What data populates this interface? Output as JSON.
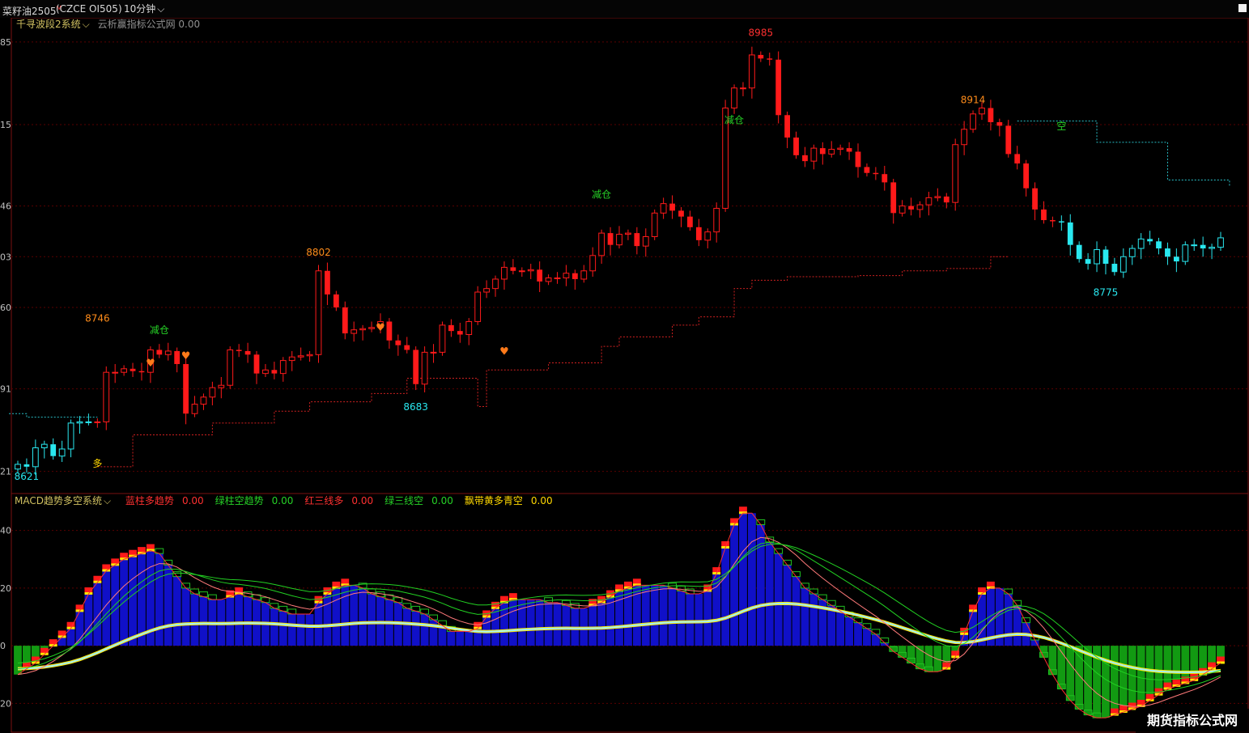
{
  "header": {
    "symbol": "菜籽油2505",
    "symbol_mark": "M",
    "code": "(CZCE OI505)",
    "period": "10分钟",
    "period_caret": "⌵"
  },
  "main_panel": {
    "indicator_name": "千寻波段2系统",
    "indicator_caret": "⌵",
    "formula_text": "云析赢指标公式网 0.00",
    "y_ticks": [
      {
        "label": "85",
        "value": 8985
      },
      {
        "label": "15",
        "value": 8915
      },
      {
        "label": "46",
        "value": 8846
      },
      {
        "label": "03",
        "value": 8803
      },
      {
        "label": "60",
        "value": 8760
      },
      {
        "label": "91",
        "value": 8691
      },
      {
        "label": "21",
        "value": 8621
      }
    ],
    "colors": {
      "up_red": "#ff1a1a",
      "down_red": "#ff1a1a",
      "cyan": "#29e8f0",
      "yellow_price": "#ff8c1a",
      "green_text": "#26d126"
    },
    "annotations": [
      {
        "text": "8621",
        "idx": 1,
        "price": 8614,
        "color": "#29e8f0"
      },
      {
        "text": "多",
        "idx": 9,
        "price": 8625,
        "color": "#ffd800"
      },
      {
        "text": "8746",
        "idx": 9,
        "price": 8748,
        "color": "#ff8c1a"
      },
      {
        "text": "减仓",
        "idx": 16,
        "price": 8738,
        "color": "#26d126"
      },
      {
        "text": "8802",
        "idx": 34,
        "price": 8804,
        "color": "#ff8c1a"
      },
      {
        "text": "8683",
        "idx": 45,
        "price": 8673,
        "color": "#29e8f0"
      },
      {
        "text": "减仓",
        "idx": 66,
        "price": 8853,
        "color": "#26d126"
      },
      {
        "text": "8985",
        "idx": 84,
        "price": 8990,
        "color": "#ff3030"
      },
      {
        "text": "减仓",
        "idx": 81,
        "price": 8916,
        "color": "#26d126"
      },
      {
        "text": "8914",
        "idx": 108,
        "price": 8933,
        "color": "#ff8c1a"
      },
      {
        "text": "空",
        "idx": 118,
        "price": 8911,
        "color": "#26d126"
      },
      {
        "text": "8775",
        "idx": 123,
        "price": 8770,
        "color": "#29e8f0"
      }
    ]
  },
  "macd_panel": {
    "indicator_name": "MACD趋势多空系统",
    "indicator_caret": "⌵",
    "legend": [
      {
        "label": "蓝柱多趋势",
        "value": "0.00",
        "label_color": "#ff3030",
        "value_color": "#ff3030"
      },
      {
        "label": "绿柱空趋势",
        "value": "0.00",
        "label_color": "#26d126",
        "value_color": "#26d126"
      },
      {
        "label": "红三线多",
        "value": "0.00",
        "label_color": "#ff3030",
        "value_color": "#ff3030"
      },
      {
        "label": "绿三线空",
        "value": "0.00",
        "label_color": "#26d126",
        "value_color": "#26d126"
      },
      {
        "label": "飘带黄多青空",
        "value": "0.00",
        "label_color": "#ffd800",
        "value_color": "#ffd800"
      }
    ],
    "y_ticks": [
      {
        "label": "40",
        "value": 40
      },
      {
        "label": "20",
        "value": 20
      },
      {
        "label": "0",
        "value": 0
      },
      {
        "label": "20",
        "value": -20
      }
    ]
  },
  "watermark": "期货指标公式网",
  "chart_data": {
    "type": "candlestick",
    "x_unit": "bar index (10-minute bars)",
    "candles_close": [
      8627,
      8625,
      8641,
      8644,
      8634,
      8640,
      8662,
      8663,
      8663,
      8663,
      8705,
      8705,
      8708,
      8706,
      8705,
      8724,
      8720,
      8723,
      8712,
      8670,
      8678,
      8684,
      8692,
      8694,
      8724,
      8723,
      8720,
      8704,
      8707,
      8704,
      8715,
      8718,
      8719,
      8720,
      8791,
      8771,
      8760,
      8738,
      8741,
      8742,
      8743,
      8748,
      8732,
      8728,
      8724,
      8695,
      8722,
      8722,
      8745,
      8740,
      8737,
      8748,
      8773,
      8776,
      8784,
      8794,
      8791,
      8791,
      8792,
      8782,
      8785,
      8785,
      8789,
      8784,
      8791,
      8804,
      8823,
      8813,
      8822,
      8823,
      8812,
      8820,
      8840,
      8848,
      8842,
      8837,
      8828,
      8817,
      8824,
      8844,
      8929,
      8946,
      8946,
      8974,
      8971,
      8970,
      8923,
      8904,
      8889,
      8884,
      8895,
      8890,
      8894,
      8895,
      8892,
      8879,
      8874,
      8873,
      8866,
      8840,
      8846,
      8843,
      8847,
      8853,
      8854,
      8849,
      8898,
      8911,
      8924,
      8929,
      8917,
      8914,
      8890,
      8882,
      8861,
      8843,
      8834,
      8833,
      8832,
      8813,
      8801,
      8797,
      8809,
      8797,
      8790,
      8803,
      8810,
      8818,
      8816,
      8810,
      8803,
      8799,
      8813,
      8813,
      8810,
      8811,
      8819
    ],
    "macd_histogram_note": "blue bars above zero = bullish, green below = bearish",
    "macd_dif_sample": [
      -10,
      -8,
      -6,
      -3,
      0,
      3,
      6,
      12,
      18,
      22,
      26,
      28,
      30,
      31,
      32,
      33,
      32,
      28,
      24,
      20,
      18,
      17,
      16,
      16,
      17,
      18,
      17,
      16,
      15,
      13,
      12,
      11,
      11,
      11,
      15,
      18,
      20,
      21,
      21,
      20,
      18,
      17,
      16,
      15,
      13,
      12,
      11,
      9,
      7,
      5,
      5,
      5,
      6,
      10,
      13,
      15,
      16,
      16,
      16,
      16,
      15,
      15,
      14,
      13,
      13,
      14,
      15,
      17,
      19,
      20,
      21,
      21,
      21,
      21,
      20,
      19,
      18,
      18,
      19,
      25,
      34,
      42,
      46,
      46,
      42,
      36,
      32,
      28,
      24,
      20,
      18,
      16,
      14,
      12,
      10,
      8,
      6,
      4,
      1,
      -2,
      -4,
      -6,
      -8,
      -9,
      -9,
      -8,
      -4,
      4,
      12,
      18,
      20,
      20,
      18,
      14,
      8,
      2,
      -4,
      -10,
      -15,
      -19,
      -22,
      -24,
      -25,
      -25,
      -24,
      -23,
      -22,
      -21,
      -19,
      -17,
      -15,
      -14,
      -13,
      -12,
      -10,
      -8,
      -6
    ]
  }
}
